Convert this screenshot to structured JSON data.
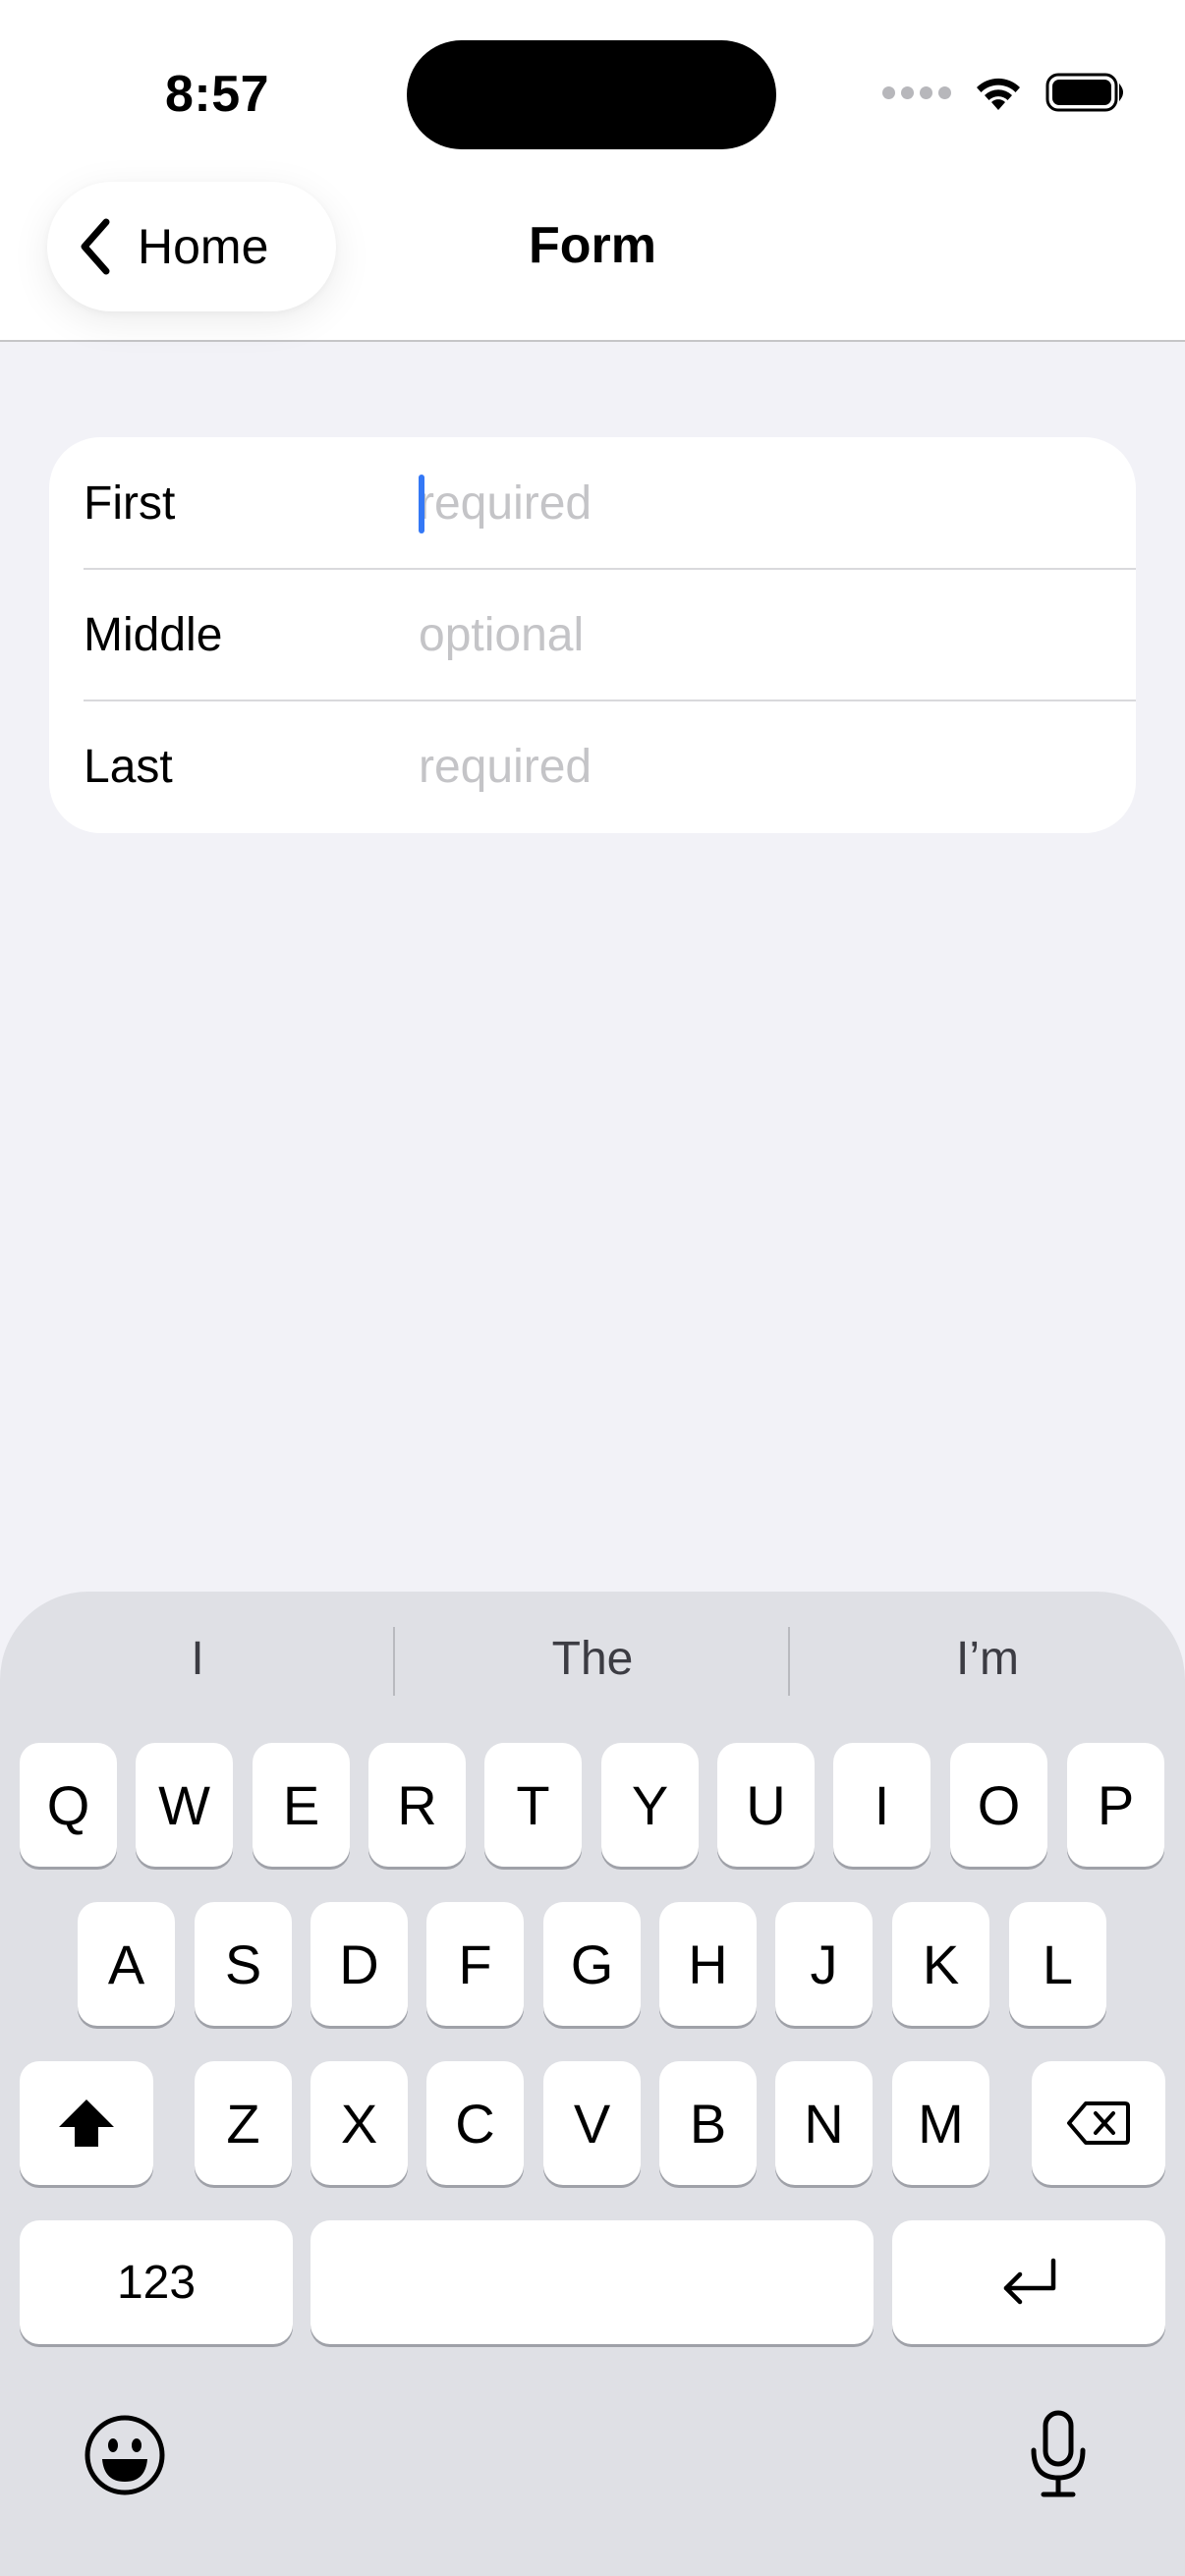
{
  "status_bar": {
    "time": "8:57"
  },
  "nav": {
    "back_label": "Home",
    "title": "Form"
  },
  "form": {
    "rows": [
      {
        "label": "First",
        "placeholder": "required",
        "value": ""
      },
      {
        "label": "Middle",
        "placeholder": "optional",
        "value": ""
      },
      {
        "label": "Last",
        "placeholder": "required",
        "value": ""
      }
    ]
  },
  "keyboard": {
    "predictions": [
      "I",
      "The",
      "I’m"
    ],
    "row1": [
      "Q",
      "W",
      "E",
      "R",
      "T",
      "Y",
      "U",
      "I",
      "O",
      "P"
    ],
    "row2": [
      "A",
      "S",
      "D",
      "F",
      "G",
      "H",
      "J",
      "K",
      "L"
    ],
    "row3": [
      "Z",
      "X",
      "C",
      "V",
      "B",
      "N",
      "M"
    ],
    "numbers_label": "123",
    "icons": {
      "shift": "shift-icon",
      "delete": "delete-icon",
      "return": "return-icon",
      "emoji": "emoji-icon",
      "mic": "microphone-icon"
    }
  },
  "colors": {
    "accent_caret": "#3478f6",
    "keyboard_bg": "#dfe0e5",
    "background": "#f2f2f7"
  }
}
